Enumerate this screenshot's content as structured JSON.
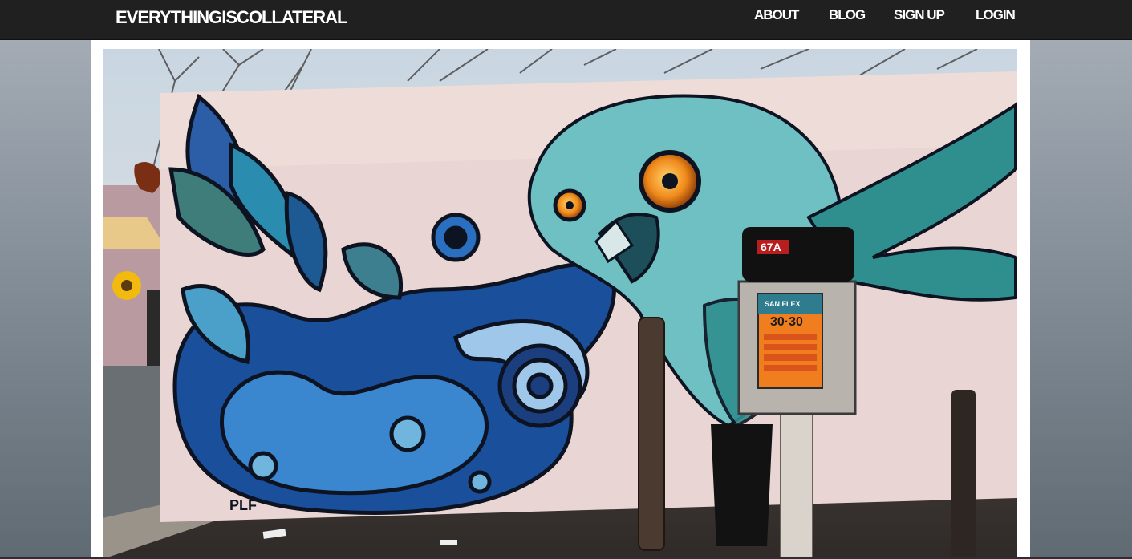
{
  "header": {
    "brand": "EVERYTHINGISCOLLATERAL",
    "nav": [
      {
        "id": "about",
        "label": "ABOUT"
      },
      {
        "id": "blog",
        "label": "BLOG"
      },
      {
        "id": "signup",
        "label": "SIGN UP"
      },
      {
        "id": "login",
        "label": "LOGIN"
      }
    ]
  },
  "photo": {
    "poster_title": "SAN FLEX",
    "poster_number": "30·30",
    "mailbox_label": "67A",
    "signature": "PLF"
  },
  "colors": {
    "topbar": "#202020",
    "panel": "#ffffff",
    "wall": "#e9d6d4",
    "owl": "#6fc0c2",
    "eye": "#f08a1c",
    "blue_dark": "#1a4f9c",
    "blue_light": "#9fc7ea"
  }
}
